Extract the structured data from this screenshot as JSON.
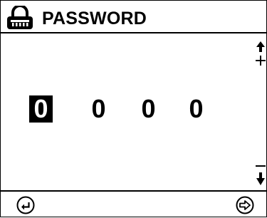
{
  "header": {
    "title": "PASSWORD",
    "icon": "lock-icon"
  },
  "digits": [
    "0",
    "0",
    "0",
    "0"
  ],
  "selected_digit_index": 0,
  "controls": {
    "increment_icon": "arrow-up-plus-icon",
    "decrement_icon": "minus-arrow-down-icon",
    "back_icon": "back-icon",
    "next_icon": "next-arrow-icon"
  }
}
